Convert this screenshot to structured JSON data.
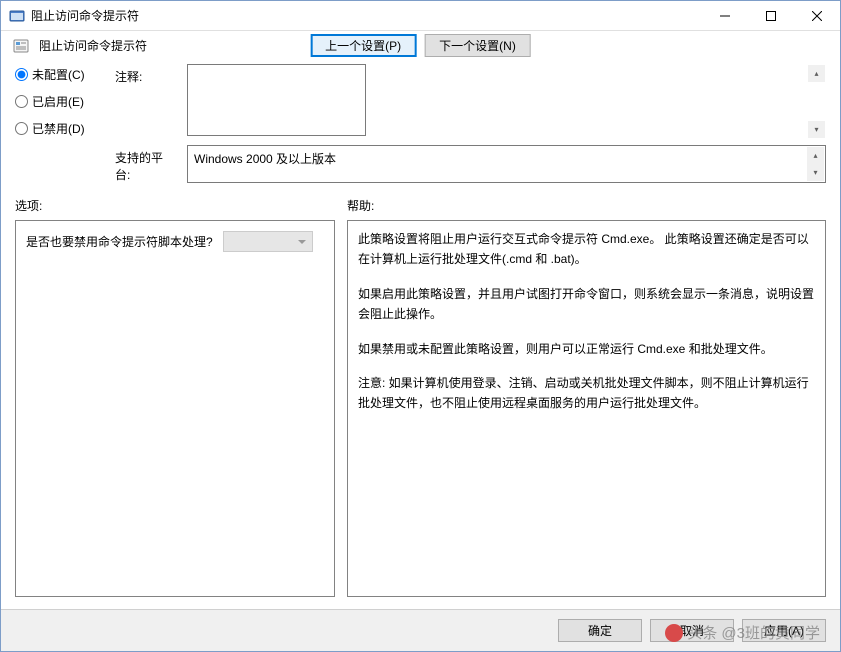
{
  "titlebar": {
    "title": "阻止访问命令提示符"
  },
  "toolbar": {
    "title": "阻止访问命令提示符",
    "prev_button": "上一个设置(P)",
    "next_button": "下一个设置(N)"
  },
  "radios": {
    "not_configured": "未配置(C)",
    "enabled": "已启用(E)",
    "disabled": "已禁用(D)"
  },
  "labels": {
    "comment": "注释:",
    "supported": "支持的平台:",
    "options": "选项:",
    "help": "帮助:"
  },
  "platform_text": "Windows 2000 及以上版本",
  "option_row": {
    "label": "是否也要禁用命令提示符脚本处理?"
  },
  "help": {
    "p1": "此策略设置将阻止用户运行交互式命令提示符 Cmd.exe。 此策略设置还确定是否可以在计算机上运行批处理文件(.cmd 和 .bat)。",
    "p2": "如果启用此策略设置，并且用户试图打开命令窗口，则系统会显示一条消息，说明设置会阻止此操作。",
    "p3": "如果禁用或未配置此策略设置，则用户可以正常运行 Cmd.exe 和批处理文件。",
    "p4": "注意: 如果计算机使用登录、注销、启动或关机批处理文件脚本，则不阻止计算机运行批处理文件，也不阻止使用远程桌面服务的用户运行批处理文件。"
  },
  "footer": {
    "ok": "确定",
    "cancel": "取消",
    "apply": "应用(A)"
  },
  "watermark": "头条 @3班的黄同学"
}
